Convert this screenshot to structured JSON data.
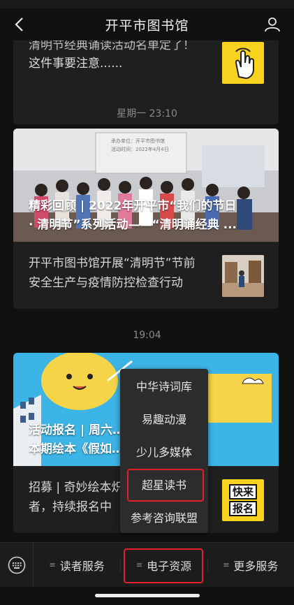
{
  "header": {
    "title": "开平市图书馆",
    "back_icon": "chevron-left-icon",
    "profile_icon": "person-icon"
  },
  "feed": {
    "top_article": {
      "line1": "清明节经典诵读活动名单定了！",
      "line2": "这件事要注意......",
      "thumb_icon": "hand-tap-icon",
      "thumb_color": "#f7d21f"
    },
    "groups": [
      {
        "time": "星期一 23:10",
        "hero": {
          "title_line1": "精彩回顾 | 2022年开平市“我们的节日",
          "title_line2": "· 清明节”系列活动——“清明诵经典 ...",
          "banner_line1": "承办单位：开平市图书馆",
          "banner_line2": "活动时间：2022年4月4日"
        },
        "sub": {
          "line1": "开平市图书馆开展“清明节”节前",
          "line2": "安全生产与疫情防控检查行动"
        }
      },
      {
        "time": "19:04",
        "hero": {
          "title_line1": "活动报名 | 周六…       …明来了!",
          "title_line2": "本期绘本《假如…       …道晚…"
        },
        "sub": {
          "line1": "招募 | 奇妙绘本炽",
          "line2": "者，持续报名中",
          "thumb_line1": "快来",
          "thumb_line2": "报名"
        }
      }
    ]
  },
  "menu": {
    "items": [
      "中华诗词库",
      "易趣动漫",
      "少儿多媒体",
      "超星读书",
      "参考咨询联盟"
    ],
    "highlighted_index": 3
  },
  "bottom_bar": {
    "keyboard_icon": "keyboard-icon",
    "tabs": [
      "读者服务",
      "电子资源",
      "更多服务"
    ],
    "highlighted_tab": 1,
    "highlight_color": "#e0202a"
  }
}
